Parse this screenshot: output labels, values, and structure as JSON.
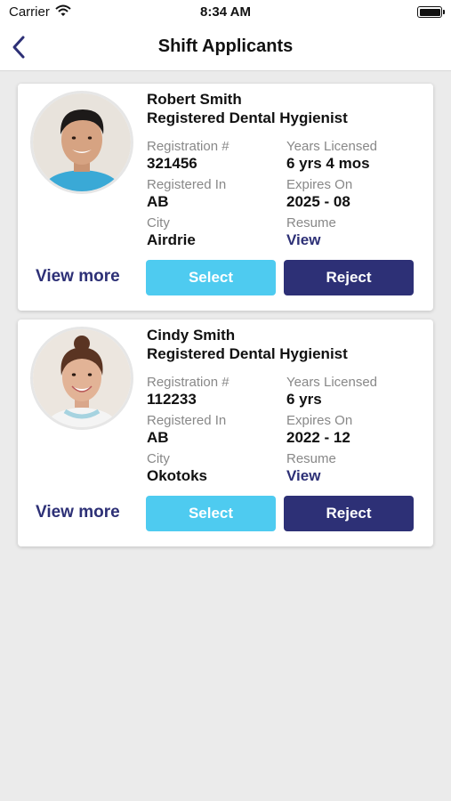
{
  "status_bar": {
    "carrier": "Carrier",
    "time": "8:34 AM"
  },
  "nav": {
    "title": "Shift Applicants"
  },
  "labels": {
    "registration": "Registration #",
    "years_licensed": "Years Licensed",
    "registered_in": "Registered In",
    "expires_on": "Expires On",
    "city": "City",
    "resume": "Resume",
    "resume_link": "View",
    "view_more": "View more",
    "select": "Select",
    "reject": "Reject"
  },
  "applicants": [
    {
      "name": "Robert Smith",
      "role": "Registered Dental Hygienist",
      "registration": "321456",
      "years_licensed": "6 yrs 4 mos",
      "registered_in": "AB",
      "expires_on": "2025 - 08",
      "city": "Airdrie"
    },
    {
      "name": "Cindy Smith",
      "role": "Registered Dental Hygienist",
      "registration": "112233",
      "years_licensed": "6 yrs",
      "registered_in": "AB",
      "expires_on": "2022 - 12",
      "city": "Okotoks"
    }
  ],
  "colors": {
    "accent": "#2d3076",
    "select_button": "#4ecbf0",
    "background": "#ebebeb"
  }
}
